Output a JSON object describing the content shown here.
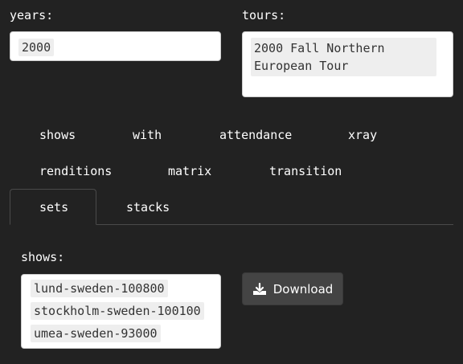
{
  "filters": {
    "years_label": "years:",
    "years_selected": [
      "2000"
    ],
    "tours_label": "tours:",
    "tours_selected": [
      "2000 Fall Northern European Tour"
    ],
    "tours_selected_lines": [
      "2000 Fall Northern",
      "European Tour"
    ]
  },
  "tabs": {
    "row1": [
      "shows",
      "with",
      "attendance",
      "xray"
    ],
    "row2": [
      "renditions",
      "matrix",
      "transition"
    ],
    "row3": [
      "sets",
      "stacks"
    ],
    "active": "sets"
  },
  "sets_panel": {
    "shows_label": "shows:",
    "shows_selected": [
      "lund-sweden-100800",
      "stockholm-sweden-100100",
      "umea-sweden-93000"
    ],
    "download_label": "Download",
    "download_icon": "download-icon"
  },
  "colors": {
    "background": "#222222",
    "button": "#444444",
    "chip": "#eeeeee"
  }
}
